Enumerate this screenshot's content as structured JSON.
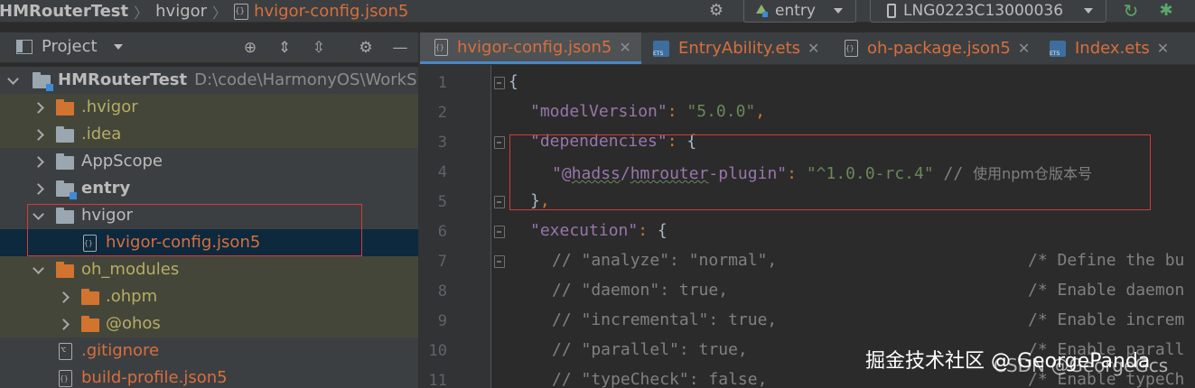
{
  "breadcrumb": {
    "project": "HMRouterTest",
    "folder": "hvigor",
    "file": "hvigor-config.json5"
  },
  "toolbar": {
    "run_config": "entry",
    "device": "LNG0223C13000036",
    "icons": [
      "settings-icon",
      "run-config-icon",
      "phone-icon",
      "apply-changes-icon",
      "debug-icon"
    ]
  },
  "project_panel": {
    "title": "Project",
    "root": {
      "name": "HMRouterTest",
      "path": "D:\\code\\HarmonyOS\\WorkSpa"
    },
    "items": [
      {
        "label": ".hvigor",
        "color": "#b5ae62"
      },
      {
        "label": ".idea",
        "color": "#b5ae62"
      },
      {
        "label": "AppScope",
        "color": "#bbbbbb"
      },
      {
        "label": "entry",
        "color": "#bbbbbb"
      },
      {
        "label": "hvigor",
        "color": "#bbbbbb"
      },
      {
        "label": "hvigor-config.json5",
        "color": "#d76f3d"
      },
      {
        "label": "oh_modules",
        "color": "#b5ae62"
      },
      {
        "label": ".ohpm",
        "color": "#b5ae62"
      },
      {
        "label": "@ohos",
        "color": "#b5ae62"
      },
      {
        "label": ".gitignore",
        "color": "#d76f3d"
      },
      {
        "label": "build-profile.json5",
        "color": "#d76f3d"
      }
    ]
  },
  "tabs": [
    {
      "label": "hvigor-config.json5",
      "active": true
    },
    {
      "label": "EntryAbility.ets",
      "active": false
    },
    {
      "label": "oh-package.json5",
      "active": false
    },
    {
      "label": "Index.ets",
      "active": false
    }
  ],
  "editor": {
    "line_numbers": [
      "1",
      "2",
      "3",
      "4",
      "5",
      "6",
      "7",
      "8",
      "9",
      "10",
      "11"
    ],
    "lines": {
      "l1": "{",
      "l2_key": "\"modelVersion\"",
      "l2_val": "\"5.0.0\"",
      "l3_key": "\"dependencies\"",
      "l4_key_a": "\"@",
      "l4_key_b": "hadss",
      "l4_key_c": "/",
      "l4_key_d": "hmrouter",
      "l4_key_e": "-plugin\"",
      "l4_val": "\"^1.0.0-rc.4\"",
      "l4_comment": "// ",
      "l4_comment_cjk": "使用npm仓版本号",
      "l5": "}",
      "l6_key": "\"execution\"",
      "l7_code": "// \"analyze\": \"normal\",",
      "l7_comment": "/* Define the bu",
      "l8_code": "// \"daemon\": true,",
      "l8_comment": "/* Enable daemon",
      "l9_code": "// \"incremental\": true,",
      "l9_comment": "/* Enable increm",
      "l10_code": "// \"parallel\": true,",
      "l10_comment": "/* Enable parall",
      "l11_code": "// \"typeCheck\": false,",
      "l11_comment": "/* Enable typeCh"
    }
  },
  "watermark": {
    "primary": "掘金技术社区 @ GeorgePanda",
    "secondary": "CSDN @GeorgeGcs"
  },
  "highlight_color": "#d23b3b"
}
